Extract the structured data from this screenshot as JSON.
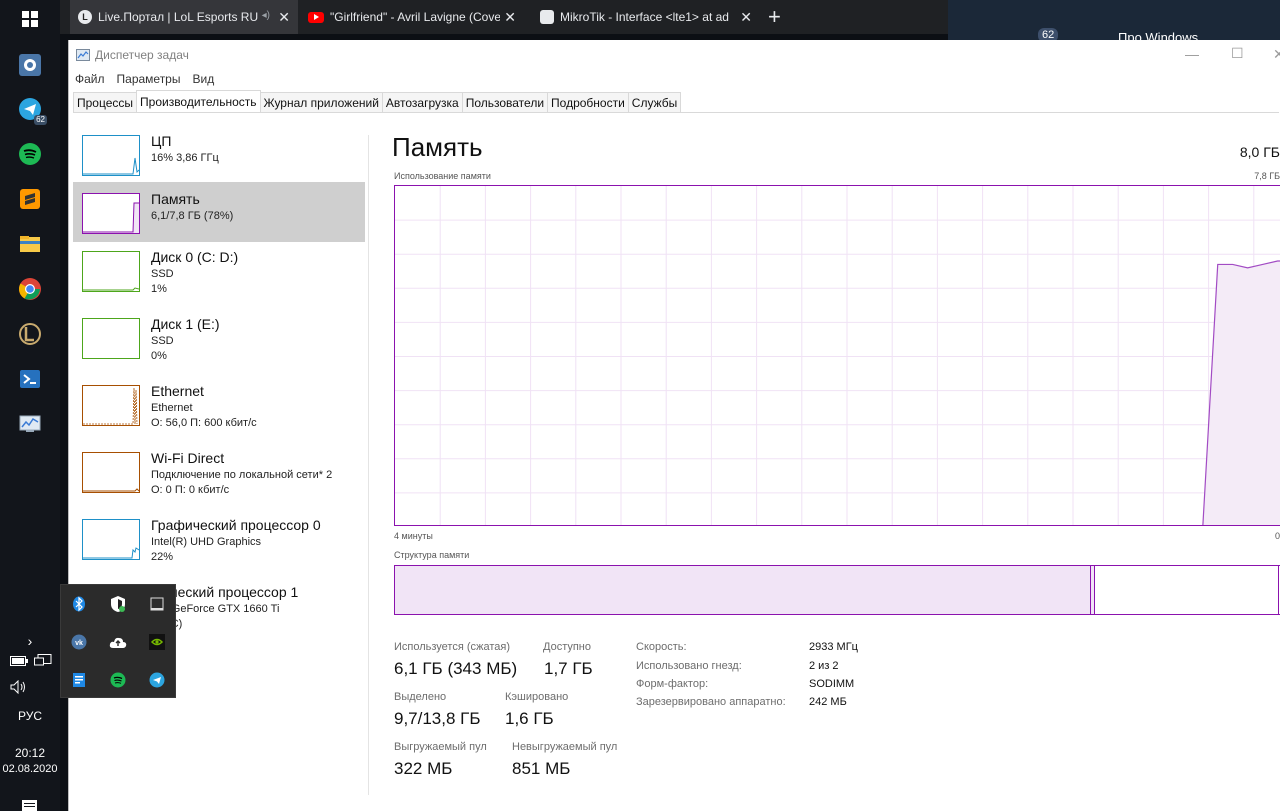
{
  "browser": {
    "tabs": [
      {
        "title": "Live.Портал | LoL Esports RU",
        "icon": "lol-icon"
      },
      {
        "title": "\"Girlfriend\" - Avril Lavigne (Cover",
        "icon": "youtube-icon"
      },
      {
        "title": "MikroTik - Interface <lte1> at ad",
        "icon": "mikrotik-icon"
      }
    ],
    "new_tab": "+",
    "behind_badge": "62",
    "behind_text": "Про Windows"
  },
  "taskbar": {
    "telegram_badge": "62",
    "lang": "РУС",
    "time": "20:12",
    "date": "02.08.2020"
  },
  "window": {
    "title": "Диспетчер задач",
    "menu": [
      "Файл",
      "Параметры",
      "Вид"
    ],
    "tabs": [
      "Процессы",
      "Производительность",
      "Журнал приложений",
      "Автозагрузка",
      "Пользователи",
      "Подробности",
      "Службы"
    ],
    "active_tab": 1
  },
  "sidebar": {
    "items": [
      {
        "name": "ЦП",
        "line1": "16% 3,86 ГГц",
        "line2": "",
        "color": "#1e90c8"
      },
      {
        "name": "Память",
        "line1": "6,1/7,8 ГБ (78%)",
        "line2": "",
        "color": "#8b12ae"
      },
      {
        "name": "Диск 0 (C: D:)",
        "line1": "SSD",
        "line2": "1%",
        "color": "#4da61b"
      },
      {
        "name": "Диск 1 (E:)",
        "line1": "SSD",
        "line2": "0%",
        "color": "#4da61b"
      },
      {
        "name": "Ethernet",
        "line1": "Ethernet",
        "line2": "О: 56,0 П: 600 кбит/с",
        "color": "#a74f01"
      },
      {
        "name": "Wi-Fi Direct",
        "line1": "Подключение по локальной сети* 2",
        "line2": "О: 0 П: 0 кбит/с",
        "color": "#a74f01"
      },
      {
        "name": "Графический процессор 0",
        "line1": "Intel(R) UHD Graphics",
        "line2": "22%",
        "color": "#1e90c8"
      },
      {
        "name": "фический процессор 1",
        "line1": "DIA GeForce GTX 1660 Ti",
        "line2": "48 °C)",
        "color": "#1e90c8"
      }
    ]
  },
  "main": {
    "title": "Память",
    "total": "8,0 ГБ",
    "usage_caption": "Использование памяти",
    "usage_max": "7,8 ГБ",
    "time_span": "4 минуты",
    "time_end": "0",
    "structure_caption": "Структура памяти",
    "usage_series": [
      0,
      0,
      0,
      0,
      0,
      0,
      0,
      0,
      0,
      0,
      0,
      0,
      0,
      0,
      0,
      0,
      0,
      0,
      0,
      0,
      0,
      0,
      0,
      0,
      0,
      0,
      0,
      0,
      0,
      0,
      0,
      0,
      0,
      0,
      0,
      0,
      0,
      0,
      0,
      0,
      0,
      0,
      0,
      0,
      0,
      0,
      0,
      0,
      0,
      0,
      0,
      0,
      0,
      0,
      0,
      77,
      77,
      76,
      77,
      78
    ],
    "stats": [
      {
        "label": "Используется (сжатая)",
        "value": "6,1 ГБ (343 МБ)"
      },
      {
        "label": "Доступно",
        "value": "1,7 ГБ"
      },
      {
        "label": "Выделено",
        "value": "9,7/13,8 ГБ"
      },
      {
        "label": "Кэшировано",
        "value": "1,6 ГБ"
      },
      {
        "label": "Выгружаемый пул",
        "value": "322 МБ"
      },
      {
        "label": "Невыгружаемый пул",
        "value": "851 МБ"
      }
    ],
    "props": [
      {
        "key": "Скорость:",
        "value": "2933 МГц"
      },
      {
        "key": "Использовано гнезд:",
        "value": "2 из 2"
      },
      {
        "key": "Форм-фактор:",
        "value": "SODIMM"
      },
      {
        "key": "Зарезервировано аппаратно:",
        "value": "242 МБ"
      }
    ]
  }
}
